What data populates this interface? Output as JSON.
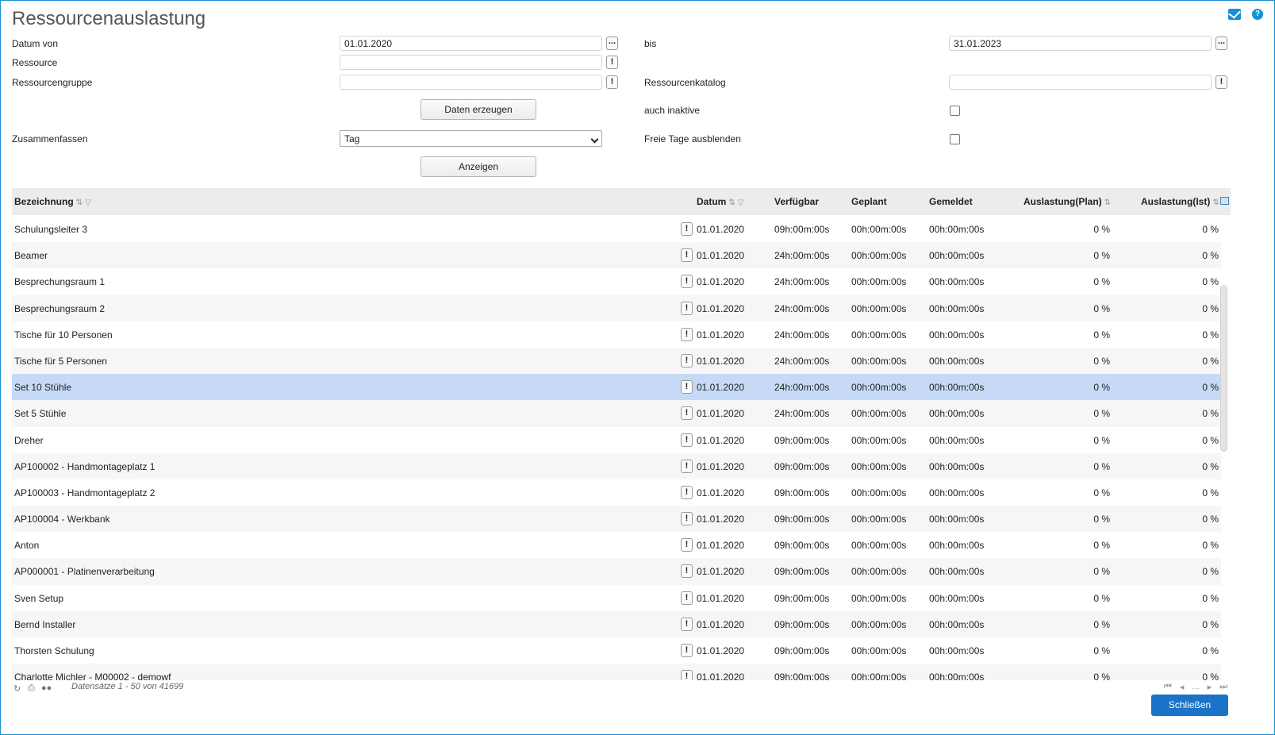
{
  "page": {
    "title": "Ressourcenauslastung"
  },
  "form": {
    "datum_von_label": "Datum von",
    "datum_von_value": "01.01.2020",
    "bis_label": "bis",
    "bis_value": "31.01.2023",
    "ressource_label": "Ressource",
    "ressource_value": "",
    "ressourcengruppe_label": "Ressourcengruppe",
    "ressourcengruppe_value": "",
    "ressourcenkatalog_label": "Ressourcenkatalog",
    "ressourcenkatalog_value": "",
    "daten_erzeugen_label": "Daten erzeugen",
    "auch_inaktive_label": "auch inaktive",
    "zusammenfassen_label": "Zusammenfassen",
    "zusammenfassen_value": "Tag",
    "freie_tage_label": "Freie Tage ausblenden",
    "anzeigen_label": "Anzeigen",
    "picker_glyph": "...",
    "lookup_glyph": "!"
  },
  "grid": {
    "headers": {
      "bezeichnung": "Bezeichnung",
      "datum": "Datum",
      "verfuegbar": "Verfügbar",
      "geplant": "Geplant",
      "gemeldet": "Gemeldet",
      "auslastung_plan": "Auslastung(Plan)",
      "auslastung_ist": "Auslastung(Ist)"
    },
    "rows": [
      {
        "name": "Schulungsleiter 3",
        "datum": "01.01.2020",
        "verfuegbar": "09h:00m:00s",
        "geplant": "00h:00m:00s",
        "gemeldet": "00h:00m:00s",
        "plan": "0 %",
        "ist": "0 %"
      },
      {
        "name": "Beamer",
        "datum": "01.01.2020",
        "verfuegbar": "24h:00m:00s",
        "geplant": "00h:00m:00s",
        "gemeldet": "00h:00m:00s",
        "plan": "0 %",
        "ist": "0 %"
      },
      {
        "name": "Besprechungsraum 1",
        "datum": "01.01.2020",
        "verfuegbar": "24h:00m:00s",
        "geplant": "00h:00m:00s",
        "gemeldet": "00h:00m:00s",
        "plan": "0 %",
        "ist": "0 %"
      },
      {
        "name": "Besprechungsraum 2",
        "datum": "01.01.2020",
        "verfuegbar": "24h:00m:00s",
        "geplant": "00h:00m:00s",
        "gemeldet": "00h:00m:00s",
        "plan": "0 %",
        "ist": "0 %"
      },
      {
        "name": "Tische für 10 Personen",
        "datum": "01.01.2020",
        "verfuegbar": "24h:00m:00s",
        "geplant": "00h:00m:00s",
        "gemeldet": "00h:00m:00s",
        "plan": "0 %",
        "ist": "0 %"
      },
      {
        "name": "Tische für 5 Personen",
        "datum": "01.01.2020",
        "verfuegbar": "24h:00m:00s",
        "geplant": "00h:00m:00s",
        "gemeldet": "00h:00m:00s",
        "plan": "0 %",
        "ist": "0 %"
      },
      {
        "name": "Set 10 Stühle",
        "datum": "01.01.2020",
        "verfuegbar": "24h:00m:00s",
        "geplant": "00h:00m:00s",
        "gemeldet": "00h:00m:00s",
        "plan": "0 %",
        "ist": "0 %",
        "selected": true
      },
      {
        "name": "Set 5 Stühle",
        "datum": "01.01.2020",
        "verfuegbar": "24h:00m:00s",
        "geplant": "00h:00m:00s",
        "gemeldet": "00h:00m:00s",
        "plan": "0 %",
        "ist": "0 %"
      },
      {
        "name": "Dreher",
        "datum": "01.01.2020",
        "verfuegbar": "09h:00m:00s",
        "geplant": "00h:00m:00s",
        "gemeldet": "00h:00m:00s",
        "plan": "0 %",
        "ist": "0 %"
      },
      {
        "name": "AP100002 - Handmontageplatz 1",
        "datum": "01.01.2020",
        "verfuegbar": "09h:00m:00s",
        "geplant": "00h:00m:00s",
        "gemeldet": "00h:00m:00s",
        "plan": "0 %",
        "ist": "0 %"
      },
      {
        "name": "AP100003 - Handmontageplatz 2",
        "datum": "01.01.2020",
        "verfuegbar": "09h:00m:00s",
        "geplant": "00h:00m:00s",
        "gemeldet": "00h:00m:00s",
        "plan": "0 %",
        "ist": "0 %"
      },
      {
        "name": "AP100004 - Werkbank",
        "datum": "01.01.2020",
        "verfuegbar": "09h:00m:00s",
        "geplant": "00h:00m:00s",
        "gemeldet": "00h:00m:00s",
        "plan": "0 %",
        "ist": "0 %"
      },
      {
        "name": "Anton",
        "datum": "01.01.2020",
        "verfuegbar": "09h:00m:00s",
        "geplant": "00h:00m:00s",
        "gemeldet": "00h:00m:00s",
        "plan": "0 %",
        "ist": "0 %"
      },
      {
        "name": "AP000001 - Platinenverarbeitung",
        "datum": "01.01.2020",
        "verfuegbar": "09h:00m:00s",
        "geplant": "00h:00m:00s",
        "gemeldet": "00h:00m:00s",
        "plan": "0 %",
        "ist": "0 %"
      },
      {
        "name": "Sven Setup",
        "datum": "01.01.2020",
        "verfuegbar": "09h:00m:00s",
        "geplant": "00h:00m:00s",
        "gemeldet": "00h:00m:00s",
        "plan": "0 %",
        "ist": "0 %"
      },
      {
        "name": "Bernd Installer",
        "datum": "01.01.2020",
        "verfuegbar": "09h:00m:00s",
        "geplant": "00h:00m:00s",
        "gemeldet": "00h:00m:00s",
        "plan": "0 %",
        "ist": "0 %"
      },
      {
        "name": "Thorsten Schulung",
        "datum": "01.01.2020",
        "verfuegbar": "09h:00m:00s",
        "geplant": "00h:00m:00s",
        "gemeldet": "00h:00m:00s",
        "plan": "0 %",
        "ist": "0 %"
      },
      {
        "name": "Charlotte Michler - M00002 - demowf",
        "datum": "01.01.2020",
        "verfuegbar": "09h:00m:00s",
        "geplant": "00h:00m:00s",
        "gemeldet": "00h:00m:00s",
        "plan": "0 %",
        "ist": "0 %"
      }
    ]
  },
  "footer": {
    "records_text": "Datensätze 1 - 50 von 41699",
    "pager_dots": "...",
    "close_label": "Schließen"
  },
  "colors": {
    "accent": "#1a8fd6",
    "selected_row": "#c6daf7",
    "close_button": "#1a73c7"
  }
}
